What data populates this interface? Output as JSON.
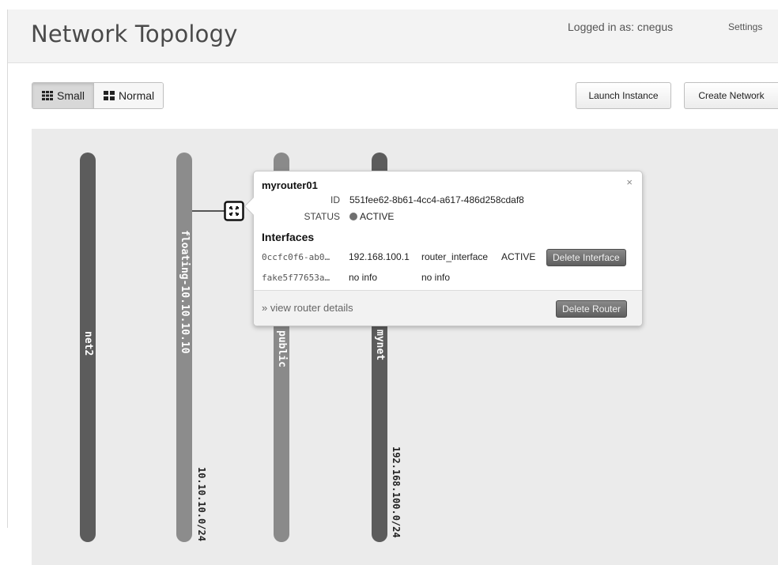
{
  "header": {
    "title": "Network Topology",
    "logged_in": "Logged in as: cnegus",
    "settings": "Settings"
  },
  "toolbar": {
    "view_toggle": [
      {
        "label": "Small",
        "icon": "grid-small-icon",
        "active": true
      },
      {
        "label": "Normal",
        "icon": "grid-large-icon",
        "active": false
      }
    ],
    "launch_instance": "Launch Instance",
    "create_network": "Create Network"
  },
  "networks": [
    {
      "name": "net2",
      "cidr": "",
      "color": "#5c5c5c"
    },
    {
      "name": "floating-10.10.10.10",
      "cidr": "10.10.10.0/24",
      "color": "#8c8c8c"
    },
    {
      "name": "public",
      "cidr": "",
      "color": "#8a8a8a"
    },
    {
      "name": "mynet",
      "cidr": "192.168.100.0/24",
      "color": "#5c5c5c"
    }
  ],
  "router": {
    "icon": "router-icon",
    "popup": {
      "name": "myrouter01",
      "close": "×",
      "id_label": "ID",
      "id_value": "551fee62-8b61-4cc4-a617-486d258cdaf8",
      "status_label": "STATUS",
      "status_value": "ACTIVE",
      "interfaces_title": "Interfaces",
      "interfaces": [
        {
          "id": "0ccfc0f6-ab0…",
          "ip": "192.168.100.1",
          "type": "router_interface",
          "status": "ACTIVE",
          "action": "Delete Interface"
        },
        {
          "id": "fake5f77653a…",
          "ip": "no info",
          "type": "no info",
          "status": "",
          "action": ""
        }
      ],
      "view_details": "» view router details",
      "delete_router": "Delete Router"
    }
  }
}
